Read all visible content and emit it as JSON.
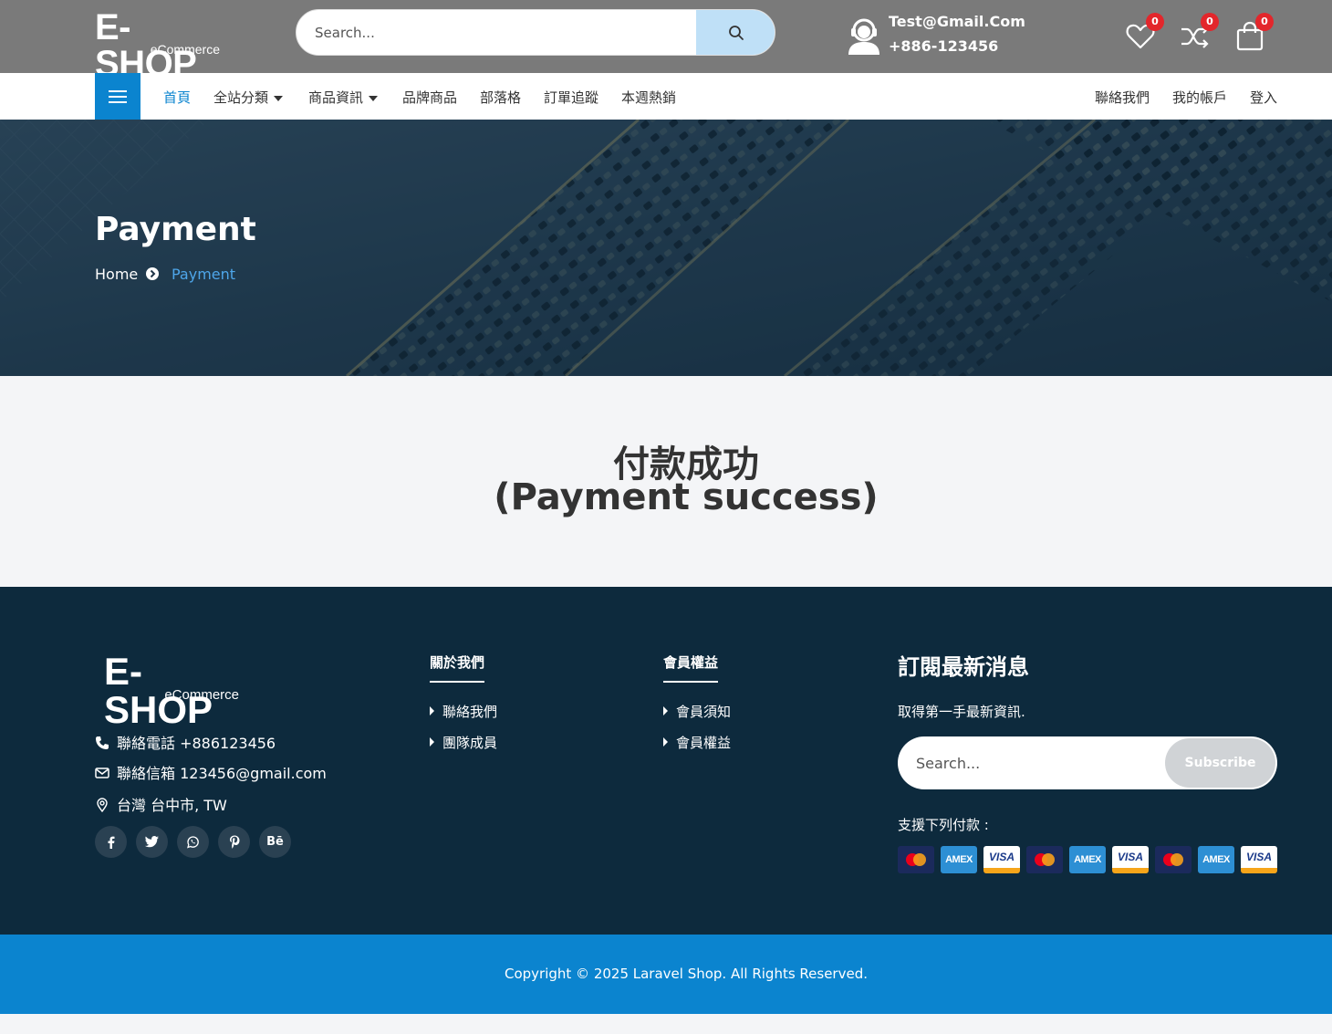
{
  "header": {
    "logo_main": "E-SHOP",
    "logo_sub": "eCommerce",
    "search_placeholder": "Search...",
    "contact_email": "Test@Gmail.Com",
    "contact_phone": "+886-123456",
    "wishlist_count": "0",
    "compare_count": "0",
    "cart_count": "0"
  },
  "nav": {
    "items": [
      {
        "label": "首頁"
      },
      {
        "label": "全站分類"
      },
      {
        "label": "商品資訊"
      },
      {
        "label": "品牌商品"
      },
      {
        "label": "部落格"
      },
      {
        "label": "訂單追蹤"
      },
      {
        "label": "本週熱銷"
      }
    ],
    "right": [
      {
        "label": "聯絡我們"
      },
      {
        "label": "我的帳戶"
      },
      {
        "label": "登入"
      }
    ]
  },
  "hero": {
    "title": "Payment",
    "breadcrumb_home": "Home",
    "breadcrumb_current": "Payment"
  },
  "main": {
    "message_line1": "付款成功",
    "message_line2": "(Payment success)"
  },
  "footer": {
    "logo_main": "E-SHOP",
    "logo_sub": "eCommerce",
    "phone": "聯絡電話 +886123456",
    "email": "聯絡信箱 123456@gmail.com",
    "address": "台灣 台中市, TW",
    "social": [
      "facebook-icon",
      "twitter-icon",
      "whatsapp-icon",
      "pinterest-icon",
      "behance-icon"
    ],
    "behance_label": "Bē",
    "about_title": "關於我們",
    "about_links": [
      {
        "label": "聯絡我們"
      },
      {
        "label": "團隊成員"
      }
    ],
    "member_title": "會員權益",
    "member_links": [
      {
        "label": "會員須知"
      },
      {
        "label": "會員權益"
      }
    ],
    "subscribe_title": "訂閱最新消息",
    "subscribe_text": "取得第一手最新資訊.",
    "subscribe_placeholder": "Search...",
    "subscribe_button": "Subscribe",
    "payment_label": "支援下列付款 :",
    "cards": [
      {
        "type": "mastercard",
        "label": "MasterCard"
      },
      {
        "type": "amex",
        "label": "AMEX"
      },
      {
        "type": "visa",
        "label": "VISA"
      },
      {
        "type": "mastercard",
        "label": "MasterCard"
      },
      {
        "type": "amex",
        "label": "AMEX"
      },
      {
        "type": "visa",
        "label": "VISA"
      },
      {
        "type": "mastercard",
        "label": "MasterCard"
      },
      {
        "type": "amex",
        "label": "AMEX"
      },
      {
        "type": "visa",
        "label": "VISA"
      }
    ]
  },
  "bottom": {
    "copyright": "Copyright © 2025 Laravel Shop. All Rights Reserved."
  },
  "colors": {
    "topbar": "#7a7a7a",
    "accent": "#0b84cf",
    "footer": "#0d2a3d",
    "badge": "#e3262b",
    "breadcrumb_active": "#4ea6ea"
  }
}
